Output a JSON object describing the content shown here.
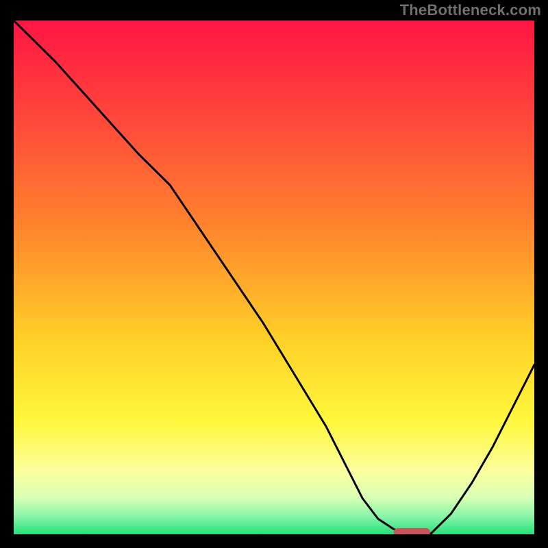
{
  "watermark": "TheBottleneck.com",
  "colors": {
    "gradient_stops": [
      {
        "offset": 0.0,
        "color": "#ff1644"
      },
      {
        "offset": 0.2,
        "color": "#ff4a3a"
      },
      {
        "offset": 0.42,
        "color": "#ff8a2c"
      },
      {
        "offset": 0.62,
        "color": "#ffd028"
      },
      {
        "offset": 0.78,
        "color": "#fff83c"
      },
      {
        "offset": 0.88,
        "color": "#fbffa0"
      },
      {
        "offset": 0.93,
        "color": "#d6ffb4"
      },
      {
        "offset": 0.965,
        "color": "#88f5a8"
      },
      {
        "offset": 1.0,
        "color": "#27e07a"
      }
    ],
    "curve": "#000000",
    "marker": "#c9545c"
  },
  "chart_data": {
    "type": "line",
    "title": "",
    "xlabel": "",
    "ylabel": "",
    "xlim": [
      0,
      100
    ],
    "ylim": [
      0,
      100
    ],
    "series": [
      {
        "name": "bottleneck-curve",
        "x": [
          0,
          8,
          16,
          24,
          30,
          36,
          42,
          48,
          54,
          60,
          64,
          67,
          70,
          73,
          76,
          80,
          84,
          88,
          92,
          96,
          100
        ],
        "y": [
          100,
          92,
          83,
          74,
          68,
          59,
          50,
          41,
          31,
          21,
          13,
          7,
          3,
          1,
          0,
          0,
          4,
          10,
          17,
          25,
          33
        ]
      }
    ],
    "marker": {
      "x_start": 73,
      "x_end": 80,
      "y": 0
    },
    "notes": "y is a qualitative bottleneck percentage read from the vertical position of the black curve; x is position along the horizontal axis (0–100)."
  }
}
